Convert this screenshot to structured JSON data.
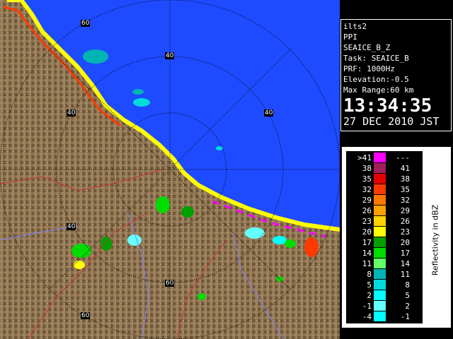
{
  "info": {
    "lines": [
      "ilts2",
      "PPI",
      "SEAICE_B_Z",
      "Task: SEAICE_B",
      "PRF: 1000Hz",
      "Elevation:-0.5",
      "Max Range:60 km"
    ],
    "time": "13:34:35",
    "date": "27 DEC 2010 JST"
  },
  "legend": {
    "unit": "Reflectivity in dBZ",
    "rows": [
      {
        "lo": ">41",
        "hi": "---",
        "color": "#ff00ff"
      },
      {
        "lo": "38",
        "hi": "41",
        "color": "#a0205a"
      },
      {
        "lo": "35",
        "hi": "38",
        "color": "#e60000"
      },
      {
        "lo": "32",
        "hi": "35",
        "color": "#ff3a00"
      },
      {
        "lo": "29",
        "hi": "32",
        "color": "#ff7800"
      },
      {
        "lo": "26",
        "hi": "29",
        "color": "#ffa000"
      },
      {
        "lo": "23",
        "hi": "26",
        "color": "#ffd200"
      },
      {
        "lo": "20",
        "hi": "23",
        "color": "#ffff00"
      },
      {
        "lo": "17",
        "hi": "20",
        "color": "#00a000"
      },
      {
        "lo": "14",
        "hi": "17",
        "color": "#00dc00"
      },
      {
        "lo": "11",
        "hi": "14",
        "color": "#64ff64"
      },
      {
        "lo": "8",
        "hi": "11",
        "color": "#00b4b4"
      },
      {
        "lo": "5",
        "hi": "8",
        "color": "#00dcdc"
      },
      {
        "lo": "2",
        "hi": "5",
        "color": "#00ffff"
      },
      {
        "lo": "-1",
        "hi": "2",
        "color": "#64ffff"
      },
      {
        "lo": "-4",
        "hi": "-1",
        "color": "#00ffff"
      }
    ]
  },
  "rings": {
    "labels": [
      "60",
      "40",
      "40",
      "40",
      "40",
      "60",
      "60"
    ]
  },
  "colors": {
    "sea": "#1e4bff",
    "land": "#8c7250",
    "coast": "#ffff00"
  }
}
